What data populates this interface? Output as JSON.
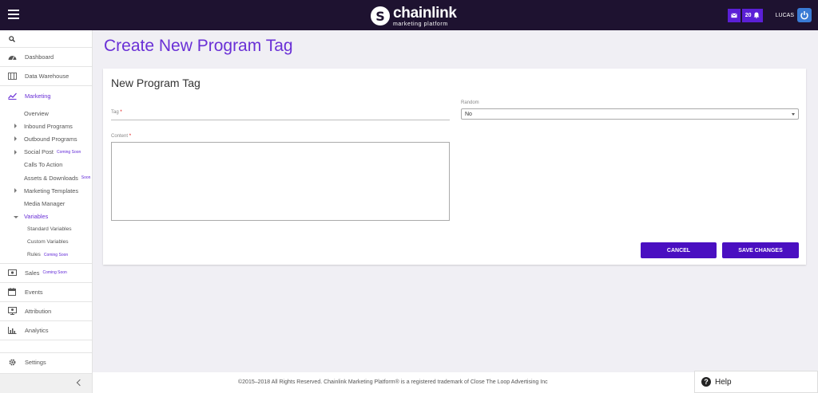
{
  "brand": {
    "name": "chainlink",
    "tagline": "marketing platform",
    "mark": "S"
  },
  "topbar": {
    "mail_icon": "mail-icon",
    "notifications_count": "20",
    "bell_icon": "bell-icon",
    "user_name": "LUCAS",
    "power_icon": "power-icon"
  },
  "sidebar": {
    "search_icon": "search-icon",
    "items": [
      {
        "label": "Dashboard",
        "icon": "dashboard-icon"
      },
      {
        "label": "Data Warehouse",
        "icon": "warehouse-icon"
      },
      {
        "label": "Marketing",
        "icon": "chart-line-icon"
      }
    ],
    "marketing_sub": [
      {
        "label": "Overview"
      },
      {
        "label": "Inbound Programs"
      },
      {
        "label": "Outbound Programs"
      },
      {
        "label": "Social Post",
        "badge": "Coming Soon"
      },
      {
        "label": "Calls To Action"
      },
      {
        "label": "Assets & Downloads",
        "badge": "Soon"
      },
      {
        "label": "Marketing Templates"
      },
      {
        "label": "Media Manager"
      },
      {
        "label": "Variables"
      }
    ],
    "variables_sub": [
      {
        "label": "Standard Variables"
      },
      {
        "label": "Custom Variables"
      },
      {
        "label": "Rules",
        "badge": "Coming Soon"
      }
    ],
    "items2": [
      {
        "label": "Sales",
        "badge": "Coming Soon",
        "icon": "money-icon"
      },
      {
        "label": "Events",
        "icon": "calendar-icon"
      },
      {
        "label": "Attribution",
        "icon": "attribution-icon"
      },
      {
        "label": "Analytics",
        "icon": "bar-chart-icon"
      }
    ],
    "settings": {
      "label": "Settings",
      "icon": "gear-icon"
    }
  },
  "page": {
    "title": "Create New Program Tag"
  },
  "form": {
    "card_title": "New Program Tag",
    "tag_label": "Tag",
    "tag_value": "",
    "random_label": "Random",
    "random_value": "No",
    "content_label": "Content",
    "content_value": "",
    "required_mark": "*",
    "cancel_label": "CANCEL",
    "save_label": "SAVE CHANGES"
  },
  "footer": {
    "text": "©2015–2018 All Rights Reserved. Chainlink Marketing Platform® is a registered trademark of Close The Loop Advertising Inc"
  },
  "help": {
    "label": "Help",
    "icon": "question-icon"
  },
  "colors": {
    "accent": "#6a30d6",
    "button": "#4a0fc1",
    "topbar": "#1e1230"
  }
}
